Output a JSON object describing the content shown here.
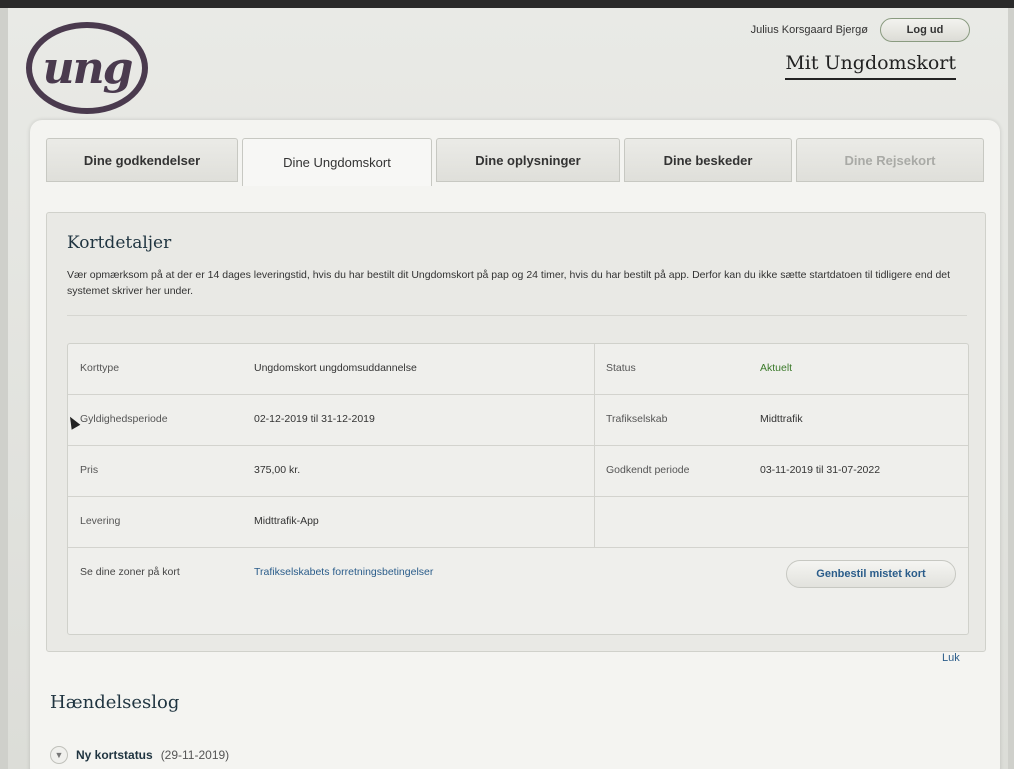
{
  "header": {
    "logo_text": "ung",
    "user_name": "Julius Korsgaard Bjergø",
    "logout_label": "Log ud",
    "site_title": "Mit Ungdomskort"
  },
  "tabs": [
    {
      "label": "Dine godkendelser",
      "state": "normal"
    },
    {
      "label": "Dine Ungdomskort",
      "state": "active"
    },
    {
      "label": "Dine oplysninger",
      "state": "normal"
    },
    {
      "label": "Dine beskeder",
      "state": "normal"
    },
    {
      "label": "Dine Rejsekort",
      "state": "disabled"
    }
  ],
  "card_details": {
    "title": "Kortdetaljer",
    "note": "Vær opmærksom på at der er 14 dages leveringstid, hvis du har bestilt dit Ungdomskort på pap og 24 timer, hvis du har bestilt på app. Derfor kan du ikke sætte startdatoen til tidligere end det systemet skriver her under.",
    "rows": [
      {
        "label": "Korttype",
        "value": "Ungdomskort ungdomsuddannelse",
        "label2": "Status",
        "value2": "Aktuelt"
      },
      {
        "label": "Gyldighedsperiode",
        "value": "02-12-2019 til 31-12-2019",
        "label2": "Trafikselskab",
        "value2": "Midttrafik"
      },
      {
        "label": "Pris",
        "value": "375,00 kr.",
        "label2": "Godkendt periode",
        "value2": "03-11-2019 til 31-07-2022"
      },
      {
        "label": "Levering",
        "value": "Midttrafik-App",
        "label2": "",
        "value2": ""
      }
    ],
    "zones_link": "Se dine zoner på kort",
    "terms_link": "Trafikselskabets forretningsbetingelser",
    "reorder_button": "Genbestil mistet kort",
    "close_link": "Luk"
  },
  "event_log": {
    "title": "Hændelseslog",
    "items": [
      {
        "text": "Ny kortstatus",
        "date": "(29-11-2019)"
      }
    ]
  },
  "colors": {
    "status_green": "#3b7a2a",
    "link_blue": "#2a5c8a",
    "logo_purple": "#4a3a4e"
  }
}
